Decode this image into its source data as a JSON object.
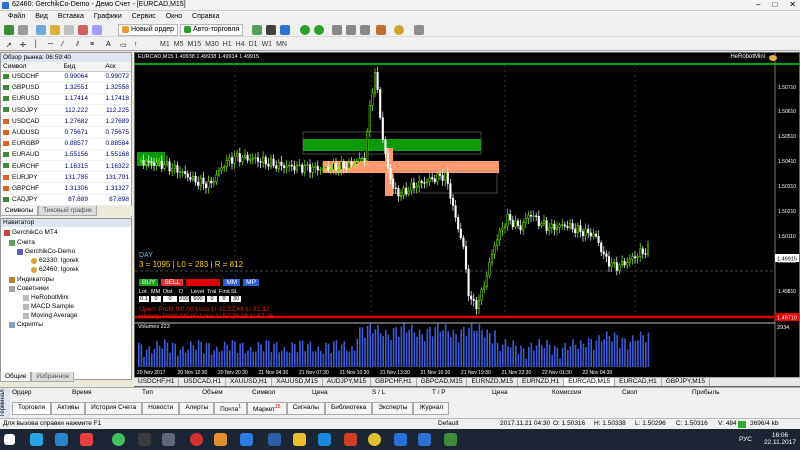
{
  "window": {
    "title": "62460: GerchikCo-Demo - Демо Счет - [EURCAD,M15]"
  },
  "menu": [
    "Файл",
    "Вид",
    "Вставка",
    "Графики",
    "Сервис",
    "Окно",
    "Справка"
  ],
  "toolbar": {
    "new_order": "Новый ордер",
    "autotrade": "Авто-торговля"
  },
  "timeframes": [
    "M1",
    "M5",
    "M15",
    "M30",
    "H1",
    "H4",
    "D1",
    "W1",
    "MN"
  ],
  "market_watch": {
    "title": "Обзор рынка: 06:59:40",
    "columns": [
      "Символ",
      "Бид",
      "Аск"
    ],
    "rows": [
      {
        "symbol": "USDCHF",
        "bid": "0.99064",
        "ask": "0.99072"
      },
      {
        "symbol": "GBPUSD",
        "bid": "1.32551",
        "ask": "1.32558"
      },
      {
        "symbol": "EURUSD",
        "bid": "1.17414",
        "ask": "1.17418"
      },
      {
        "symbol": "USDJPY",
        "bid": "112.222",
        "ask": "112.225"
      },
      {
        "symbol": "USDCAD",
        "bid": "1.27682",
        "ask": "1.27689"
      },
      {
        "symbol": "AUDUSD",
        "bid": "0.75671",
        "ask": "0.75675"
      },
      {
        "symbol": "EURGBP",
        "bid": "0.88577",
        "ask": "0.88584"
      },
      {
        "symbol": "EURAUD",
        "bid": "1.55156",
        "ask": "1.55168"
      },
      {
        "symbol": "EURCHF",
        "bid": "1.16315",
        "ask": "1.16322"
      },
      {
        "symbol": "EURJPY",
        "bid": "131.785",
        "ask": "131.791"
      },
      {
        "symbol": "GBPCHF",
        "bid": "1.31306",
        "ask": "1.31327"
      },
      {
        "symbol": "CADJPY",
        "bid": "87.889",
        "ask": "87.898"
      },
      {
        "symbol": "GBPJPY",
        "bid": "148.761",
        "ask": "148.771"
      }
    ],
    "tabs": [
      "Символы",
      "Тиковый график"
    ]
  },
  "navigator": {
    "title": "Навигатор",
    "root": "GerchikCo MT4",
    "accounts_label": "Счета",
    "server": "GerchikCo-Demo",
    "accounts": [
      "62330: Igorek",
      "62460: Igorek"
    ],
    "indicators": "Индикаторы",
    "advisors": "Советники",
    "advisor_items": [
      "HeRobotMini",
      "MACD Sample",
      "Moving Average"
    ],
    "scripts": "Скрипты",
    "tabs": [
      "Общие",
      "Избранное"
    ]
  },
  "chart": {
    "header": "EURCAD,M15  1.49938 1.49938 1.49914 1.49915",
    "ea_name": "HeRobotMini",
    "price_labels": [
      "1.50710",
      "1.50610",
      "1.50510",
      "1.50410",
      "1.50310",
      "1.50210",
      "1.50110",
      "1.50010",
      "1.49915",
      "1.49810",
      "1.49710"
    ],
    "current_price": "1.49915",
    "red_line_price": "1.49710",
    "time_labels": [
      "20 Nov 2017",
      "20 Nov 12:30",
      "20 Nov 20:30",
      "21 Nov 04:30",
      "21 Nov 07:30",
      "21 Nov 10:30",
      "21 Nov 13:30",
      "21 Nov 16:30",
      "21 Nov 19:30",
      "21 Nov 22:30",
      "22 Nov 01:30",
      "22 Nov 04:30"
    ],
    "day_label": "DAY",
    "stats": "3  = 1095 | L0 = 283 | R = 812",
    "buttons": [
      "BUY",
      "SELL",
      "CLOSE",
      "MM",
      "MP"
    ],
    "param_labels": [
      "Lot",
      "MM",
      "Dist",
      "D",
      "Level",
      "Tral",
      "First",
      "SL"
    ],
    "param_values": [
      "0.1",
      "0",
      "0",
      "200",
      "500",
      "0",
      "0",
      "30"
    ],
    "open_line": "Open:  Profit 0/0.00  Loss 1/-31.32  All 1/-31.32",
    "history_line": "History: Profit 0/0.00  Loss 1/-57.76  All 1/-57.76",
    "volume_label": "Volumes 223",
    "volume_max": "2934"
  },
  "chart_tabs": [
    "USDCHF,H1",
    "USDCAD,H1",
    "XAUUSD,H1",
    "XAUUSD,M15",
    "AUDJPY,M15",
    "GBPCHF,H1",
    "GBPCAD,M15",
    "EURNZD,M15",
    "EURNZD,H1",
    "EURCAD,M15",
    "EURCAD,H1",
    "GBPJPY,M15"
  ],
  "terminal": {
    "side_label": "Терминал",
    "columns": [
      "Ордер",
      "Время",
      "Тип",
      "Объем",
      "Символ",
      "Цена",
      "S / L",
      "T / P",
      "Цена",
      "Комиссия",
      "Своп",
      "Прибыль"
    ],
    "tabs": [
      "Торговля",
      "Активы",
      "История Счета",
      "Новости",
      "Алерты",
      "Почта",
      "Маркет",
      "Сигналы",
      "Библиотека",
      "Эксперты",
      "Журнал"
    ],
    "mail_count": "1",
    "market_count": "15"
  },
  "status": {
    "help": "Для вызова справки нажмите F1",
    "profile": "Default",
    "datetime": "2017.11.21 04:30",
    "open": "O: 1.50316",
    "high": "H: 1.50338",
    "low": "L: 1.50296",
    "close": "C: 1.50316",
    "volume": "V: 484",
    "traffic": "3696/4 kb"
  },
  "taskbar": {
    "lang": "РУС",
    "time": "16:06",
    "date": "22.11.2017"
  },
  "colors": {
    "bull": "#7cfc00",
    "bear": "#ffffff",
    "green_zone": "#0a9a0a",
    "orange_zone": "#ff9a70",
    "red_line": "#e00000",
    "volume": "#3b5bd8"
  }
}
